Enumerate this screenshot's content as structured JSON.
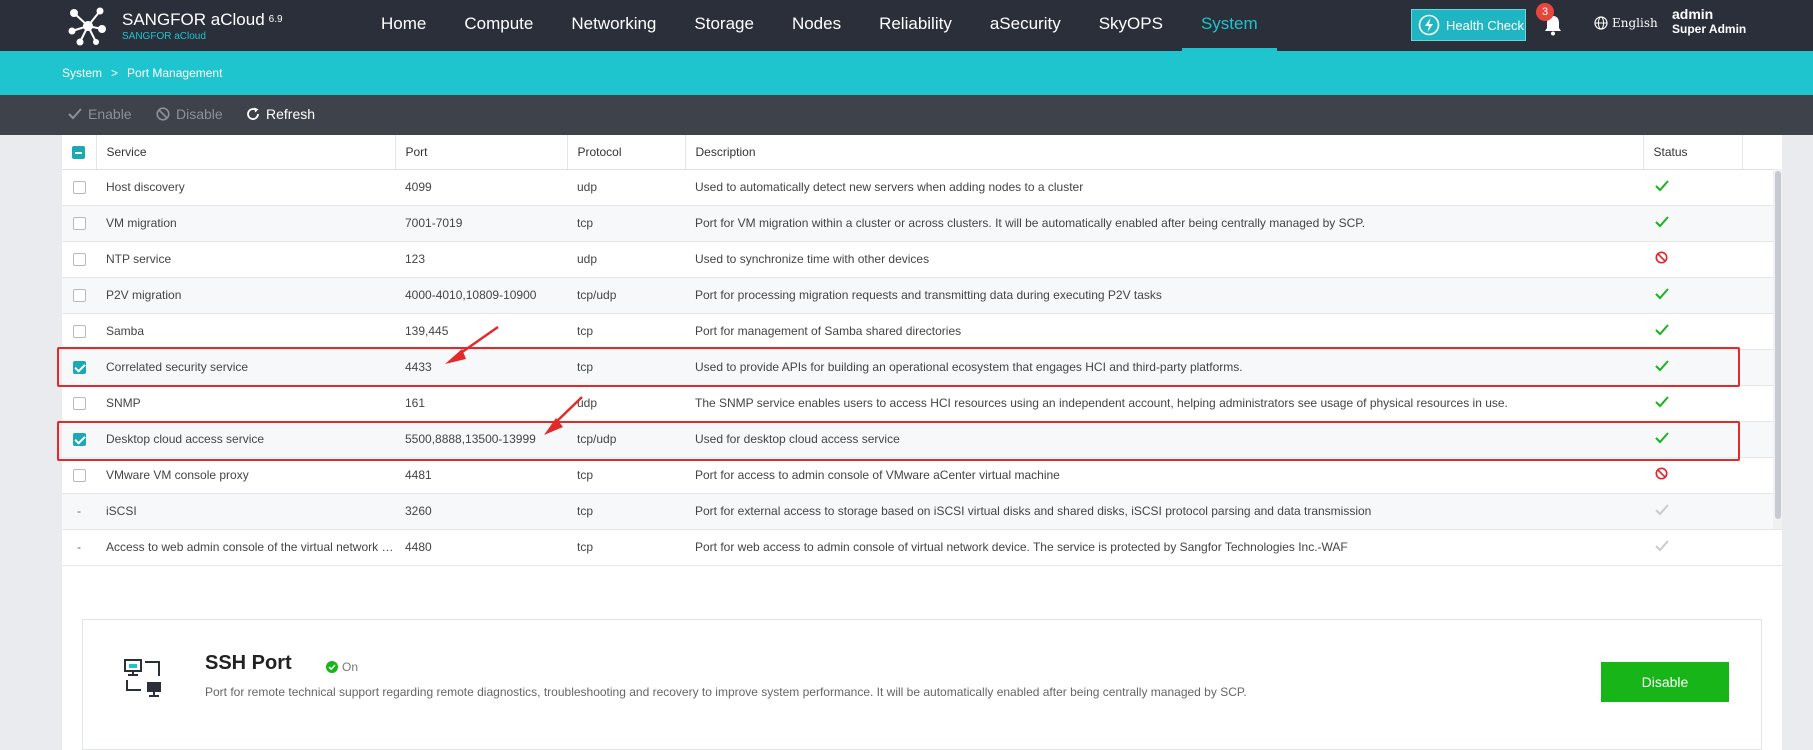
{
  "app": {
    "brand": "SANGFOR aCloud",
    "version": "6.9",
    "brand_sub": "SANGFOR aCloud"
  },
  "nav": {
    "items": [
      {
        "label": "Home"
      },
      {
        "label": "Compute"
      },
      {
        "label": "Networking"
      },
      {
        "label": "Storage"
      },
      {
        "label": "Nodes"
      },
      {
        "label": "Reliability"
      },
      {
        "label": "aSecurity"
      },
      {
        "label": "SkyOPS"
      },
      {
        "label": "System",
        "active": true
      }
    ],
    "health_check": "Health Check",
    "notification_count": "3",
    "language": "English",
    "user": "admin",
    "role": "Super Admin"
  },
  "breadcrumb": {
    "root": "System",
    "separator": ">",
    "current": "Port Management"
  },
  "toolbar": {
    "enable": "Enable",
    "disable": "Disable",
    "refresh": "Refresh"
  },
  "table": {
    "columns": [
      "Service",
      "Port",
      "Protocol",
      "Description",
      "Status"
    ],
    "rows": [
      {
        "check": "off",
        "service": "Host discovery",
        "port": "4099",
        "protocol": "udp",
        "description": "Used to automatically detect new servers when adding nodes to a cluster",
        "status": "enabled"
      },
      {
        "check": "off",
        "service": "VM migration",
        "port": "7001-7019",
        "protocol": "tcp",
        "description": "Port for VM migration within a cluster or across clusters. It will be automatically enabled after being centrally managed by SCP.",
        "status": "enabled"
      },
      {
        "check": "off",
        "service": "NTP service",
        "port": "123",
        "protocol": "udp",
        "description": "Used to synchronize time with other devices",
        "status": "disabled"
      },
      {
        "check": "off",
        "service": "P2V migration",
        "port": "4000-4010,10809-10900",
        "protocol": "tcp/udp",
        "description": "Port for processing migration requests and transmitting data during executing P2V tasks",
        "status": "enabled"
      },
      {
        "check": "off",
        "service": "Samba",
        "port": "139,445",
        "protocol": "tcp",
        "description": "Port for management of Samba shared directories",
        "status": "enabled"
      },
      {
        "check": "on",
        "service": "Correlated security service",
        "port": "4433",
        "protocol": "tcp",
        "description": "Used to provide APIs for building an operational ecosystem that engages HCI and third-party platforms.",
        "status": "enabled"
      },
      {
        "check": "off",
        "service": "SNMP",
        "port": "161",
        "protocol": "udp",
        "description": "The SNMP service enables users to access HCI resources using an independent account, helping administrators see usage of physical resources in use.",
        "status": "enabled"
      },
      {
        "check": "on",
        "service": "Desktop cloud access service",
        "port": "5500,8888,13500-13999",
        "protocol": "tcp/udp",
        "description": "Used for desktop cloud access service",
        "status": "enabled"
      },
      {
        "check": "off",
        "service": "VMware VM console proxy",
        "port": "4481",
        "protocol": "tcp",
        "description": "Port for access to admin console of VMware aCenter virtual machine",
        "status": "disabled"
      },
      {
        "check": "none",
        "check_text": "-",
        "service": "iSCSI",
        "port": "3260",
        "protocol": "tcp",
        "description": "Port for external access to storage based on iSCSI virtual disks and shared disks, iSCSI protocol parsing and data transmission",
        "status": "fixed"
      },
      {
        "check": "none",
        "check_text": "-",
        "service": "Access to web admin console of the virtual network device",
        "port": "4480",
        "protocol": "tcp",
        "description": "Port for web access to admin console of virtual network device. The service is protected by Sangfor Technologies Inc.-WAF",
        "status": "fixed"
      }
    ]
  },
  "ssh": {
    "title": "SSH Port",
    "status": "On",
    "description": "Port for remote technical support regarding remote diagnostics, troubleshooting and recovery to improve system performance. It will be automatically enabled after being centrally managed by SCP.",
    "button": "Disable"
  },
  "colors": {
    "topbar": "#2a2f39",
    "accent": "#1ec5cf",
    "toolbar": "#3d424b",
    "enabled": "#19b419",
    "disabled": "#e0282f",
    "annotation": "#e22a2a"
  }
}
